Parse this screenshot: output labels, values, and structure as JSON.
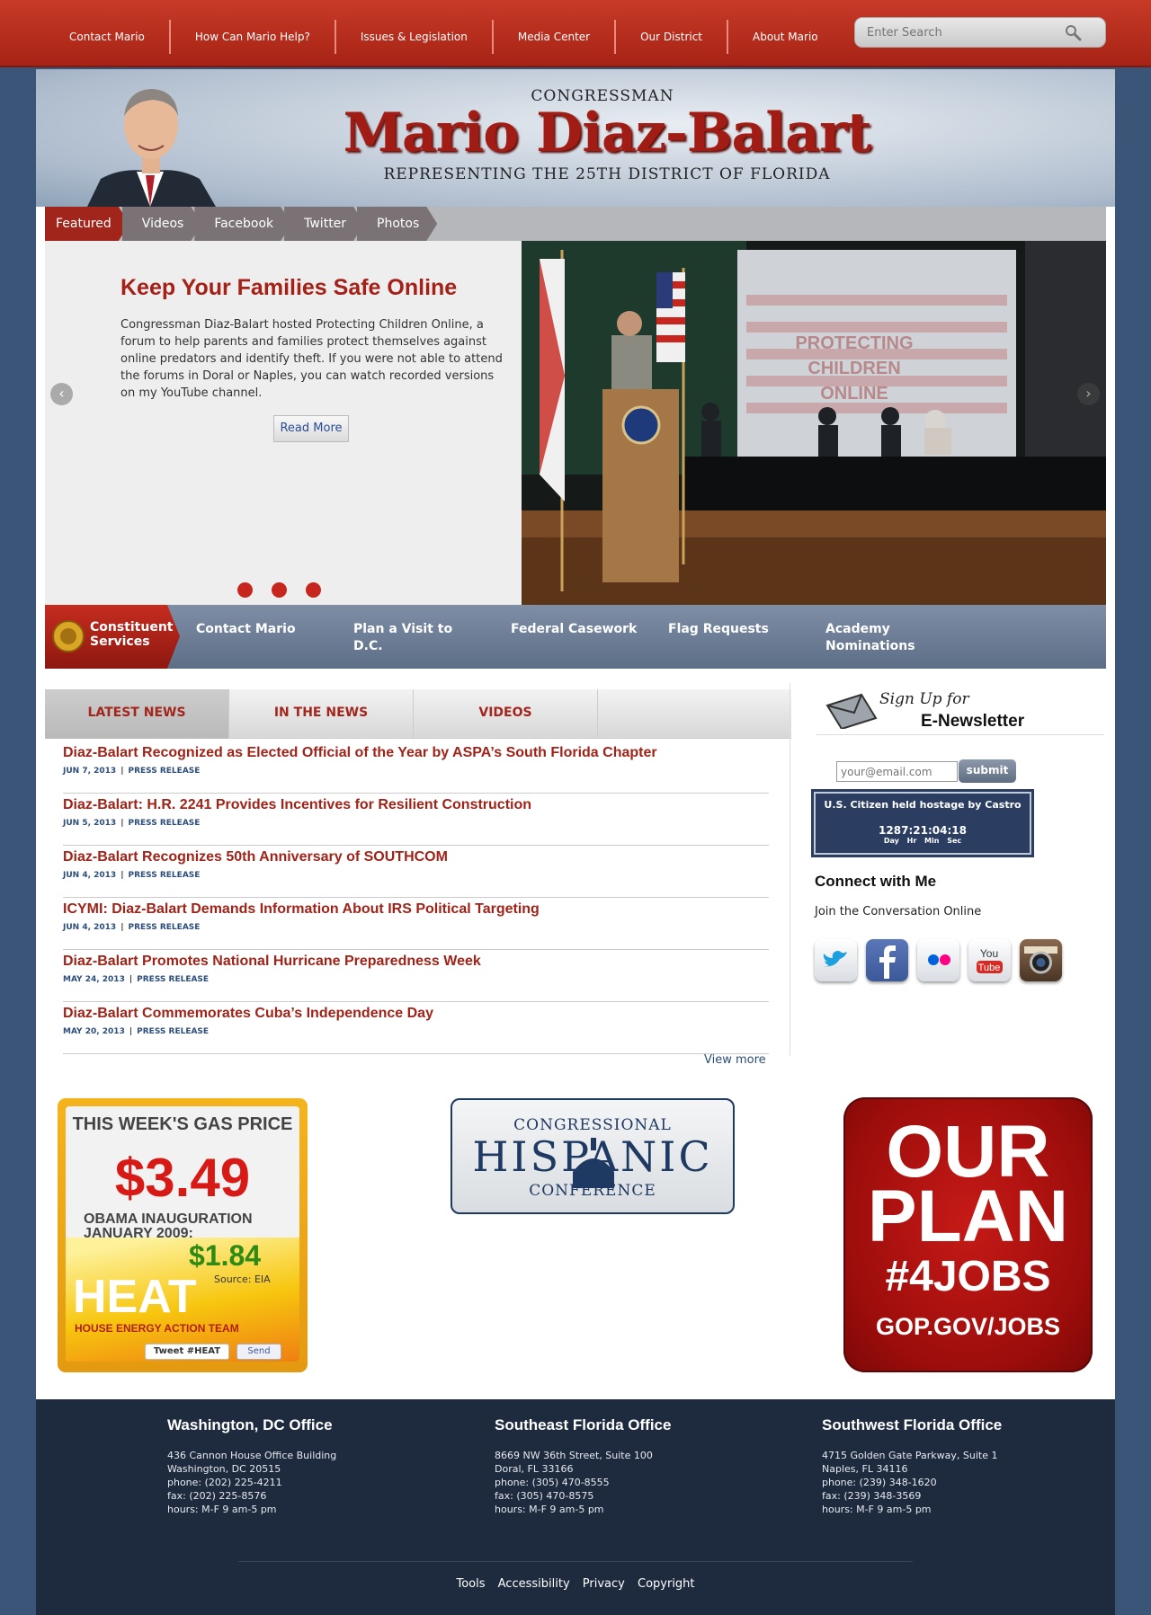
{
  "topnav": {
    "items": [
      "Contact Mario",
      "How Can Mario Help?",
      "Issues & Legislation",
      "Media Center",
      "Our District",
      "About Mario"
    ],
    "search_placeholder": "Enter Search"
  },
  "header": {
    "title_small": "CONGRESSMAN",
    "name": "Mario Diaz-Balart",
    "subtitle": "REPRESENTING THE 25TH DISTRICT OF FLORIDA"
  },
  "tabs": [
    "Featured",
    "Videos",
    "Facebook",
    "Twitter",
    "Photos"
  ],
  "slide": {
    "title": "Keep Your Families Safe Online",
    "body": "Congressman Diaz-Balart hosted Protecting Children Online, a forum to help parents and families protect themselves against online predators and identify theft. If you were not able to attend the forums in Doral or Naples, you can watch recorded versions on my YouTube channel.",
    "read_more": "Read More",
    "screen_text": [
      "PROTECTING",
      "CHILDREN",
      "ONLINE"
    ]
  },
  "constituent": {
    "label_line1": "Constituent",
    "label_line2": "Services",
    "links": [
      "Contact Mario",
      "Plan a Visit to D.C.",
      "Federal Casework",
      "Flag Requests",
      "Academy Nominations"
    ]
  },
  "news": {
    "tabs": [
      "LATEST NEWS",
      "IN THE NEWS",
      "VIDEOS"
    ],
    "items": [
      {
        "title": "Diaz-Balart Recognized as Elected Official of the Year by ASPA’s South Florida Chapter",
        "date": "JUN 7, 2013",
        "type": "PRESS RELEASE"
      },
      {
        "title": "Diaz-Balart: H.R. 2241 Provides Incentives for Resilient Construction",
        "date": "JUN 5, 2013",
        "type": "PRESS RELEASE"
      },
      {
        "title": "Diaz-Balart Recognizes 50th Anniversary of SOUTHCOM",
        "date": "JUN 4, 2013",
        "type": "PRESS RELEASE"
      },
      {
        "title": "ICYMI: Diaz-Balart Demands Information About IRS Political Targeting",
        "date": "JUN 4, 2013",
        "type": "PRESS RELEASE"
      },
      {
        "title": "Diaz-Balart Promotes National Hurricane Preparedness Week",
        "date": "MAY 24, 2013",
        "type": "PRESS RELEASE"
      },
      {
        "title": "Diaz-Balart Commemorates Cuba’s Independence Day",
        "date": "MAY 20, 2013",
        "type": "PRESS RELEASE"
      }
    ],
    "view_more": "View more"
  },
  "sidebar": {
    "signup_line1": "Sign Up for",
    "signup_line2": "E-Newsletter",
    "email_placeholder": "your@email.com",
    "submit": "submit",
    "hostage_title": "U.S. Citizen held hostage by Castro",
    "hostage_counter": "1287:21:04:18",
    "hostage_units": "Day Hr Min Sec",
    "connect_title": "Connect with Me",
    "connect_sub": "Join the Conversation Online",
    "social": [
      "twitter-icon",
      "facebook-icon",
      "flickr-icon",
      "youtube-icon",
      "instagram-icon"
    ]
  },
  "banners": {
    "gas": {
      "line1": "THIS WEEK'S GAS PRICE",
      "price": "$3.49",
      "line2": "OBAMA INAUGURATION JANUARY 2009:",
      "old_price": "$1.84",
      "source": "Source: EIA",
      "heat": "HEAT",
      "heat_sub": "HOUSE ENERGY ACTION TEAM",
      "tweet": "Tweet #HEAT",
      "send": "Send"
    },
    "chc": {
      "line1": "CONGRESSIONAL",
      "line2": "HISPANIC",
      "line3": "CONFERENCE"
    },
    "plan": {
      "line1": "OUR",
      "line2": "PLAN",
      "line3": "#4JOBS",
      "line4": "GOP.GOV/JOBS"
    }
  },
  "footer": {
    "offices": [
      {
        "name": "Washington, DC Office",
        "lines": [
          "436 Cannon House Office Building",
          "Washington, DC 20515",
          "phone: (202) 225-4211",
          "fax: (202) 225-8576",
          "hours: M-F 9 am-5 pm"
        ]
      },
      {
        "name": "Southeast Florida Office",
        "lines": [
          "8669 NW 36th Street, Suite 100",
          "Doral, FL 33166",
          "phone: (305) 470-8555",
          "fax: (305) 470-8575",
          "hours: M-F 9 am-5 pm"
        ]
      },
      {
        "name": "Southwest Florida Office",
        "lines": [
          "4715 Golden Gate Parkway, Suite 1",
          "Naples, FL 34116",
          "phone: (239) 348-1620",
          "fax: (239) 348-3569",
          "hours: M-F 9 am-5 pm"
        ]
      }
    ],
    "links": [
      "Tools",
      "Accessibility",
      "Privacy",
      "Copyright"
    ]
  },
  "colors": {
    "brand_red": "#a72315",
    "navy": "#1e2b3f",
    "link_blue": "#2d4e7a"
  }
}
